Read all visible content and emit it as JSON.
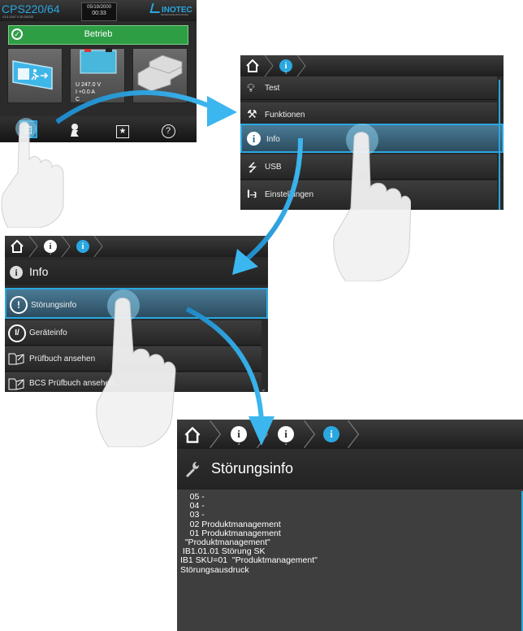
{
  "main_screen": {
    "model": "CPS220/64",
    "serial": "V13.1047.0.ID.00035",
    "date": "05/19/2000",
    "time": "00:33",
    "logo": "INOTEC",
    "logo_sub": "Sicherheitstechnik GmbH",
    "status_label": "Betrieb",
    "battery_readout": {
      "line1": "U   247.0  V",
      "line2": "I     +0.0  A",
      "line3": "C"
    },
    "bottom_icons": [
      "menu-icon",
      "person-pointer-icon",
      "star-icon",
      "help-icon"
    ],
    "help_glyph": "?"
  },
  "menu_panel": {
    "items": [
      {
        "label": "Test",
        "icon": "lightbulb-icon"
      },
      {
        "label": "Funktionen",
        "icon": "wrench-icon"
      },
      {
        "label": "Info",
        "icon": "info-icon"
      },
      {
        "label": "USB",
        "icon": "usb-icon"
      },
      {
        "label": "Einstellungen",
        "icon": "settings-icon"
      }
    ],
    "crumb_sub": "1"
  },
  "info_panel": {
    "title": "Info",
    "items": [
      {
        "label": "Störungsinfo",
        "icon": "alert-icon"
      },
      {
        "label": "Geräteinfo",
        "icon": "device-info-icon"
      },
      {
        "label": "Prüfbuch ansehen",
        "icon": "logbook-icon"
      },
      {
        "label": "BCS Prüfbuch ansehen",
        "icon": "logbook-icon"
      }
    ],
    "crumb_sub": "1"
  },
  "fault_panel": {
    "title": "Störungsinfo",
    "crumb_sub_1": "1",
    "crumb_sub_2": "1",
    "lines": [
      "    05 -",
      "    04 -",
      "    03 -",
      "    02 Produktmanagement",
      "    01 Produktmanagement",
      "  \"Produktmanagement\"",
      " IB1.01.01 Störung SK",
      "IB1 SKU=01  \"Produktmanagement\"",
      "Störungsausdruck"
    ]
  },
  "colors": {
    "accent": "#2aa7e0",
    "status_green": "#2e9e45",
    "panel_dark": "#2a2a2a"
  }
}
